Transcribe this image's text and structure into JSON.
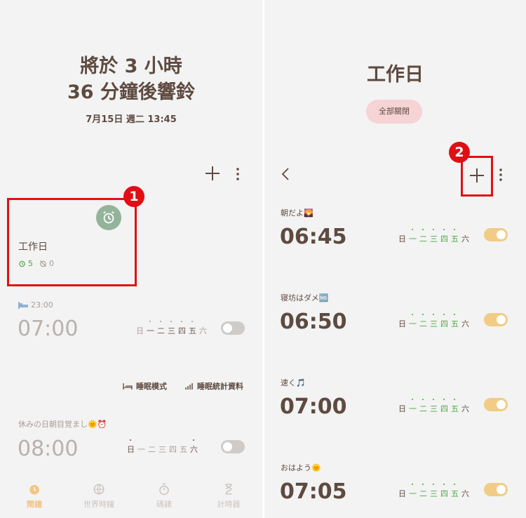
{
  "left": {
    "headline_line1": "將於 3 小時",
    "headline_line2": "36 分鐘後響鈴",
    "date": "7月15日 週二 13:45",
    "group": {
      "name": "工作日",
      "on_count": "5",
      "off_count": "0",
      "badge": "1"
    },
    "bedtime": {
      "time_label": "23:00",
      "wake_time": "07:00",
      "days": [
        "日",
        "一",
        "二",
        "三",
        "四",
        "五",
        "六"
      ]
    },
    "links": {
      "sleep_mode": "睡眠模式",
      "sleep_stats": "睡眠統計資料"
    },
    "weekend_alarm": {
      "label": "休みの日朝目覚まし🌞⏰",
      "time": "08:00",
      "days": [
        "日",
        "一",
        "二",
        "三",
        "四",
        "五",
        "六"
      ]
    },
    "nav": {
      "alarm": "鬧鐘",
      "world_clock": "世界時鐘",
      "stopwatch": "碼錶",
      "timer": "計時器"
    }
  },
  "right": {
    "title": "工作日",
    "all_off_button": "全部關閉",
    "badge": "2",
    "alarms": [
      {
        "label": "朝だよ🌄",
        "time": "06:45"
      },
      {
        "label": "寝坊はダメ🆖",
        "time": "06:50"
      },
      {
        "label": "速く🎵",
        "time": "07:00"
      },
      {
        "label": "おはよう🌞",
        "time": "07:05"
      }
    ],
    "days": [
      "日",
      "一",
      "二",
      "三",
      "四",
      "五",
      "六"
    ]
  },
  "colors": {
    "background": "#f3f3f3",
    "text_dark": "#5e4a40",
    "accent_green": "#4aa742",
    "toggle_on": "#f0cc86",
    "toggle_off": "#cfcbc9",
    "highlight_red": "#e00f14",
    "nav_active": "#f3c583"
  }
}
